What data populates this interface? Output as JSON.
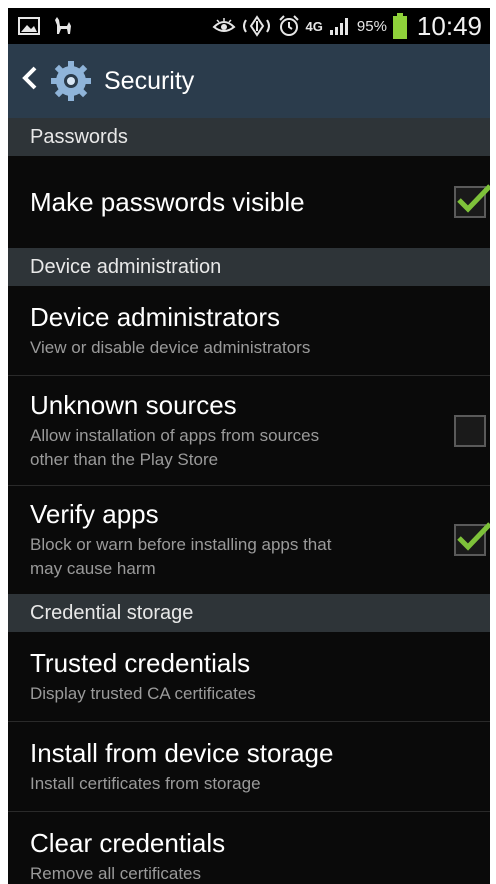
{
  "status_bar": {
    "battery_percent": "95%",
    "network": "4G",
    "time": "10:49",
    "icons": [
      "gallery-icon",
      "cat-icon",
      "eye-icon",
      "nfc-icon",
      "alarm-icon",
      "network-4g-icon",
      "signal-icon",
      "battery-icon"
    ]
  },
  "action_bar": {
    "title": "Security",
    "back_icon": "back-chevron-icon",
    "app_icon": "settings-gear-icon"
  },
  "sections": {
    "passwords": "Passwords",
    "device_admin": "Device administration",
    "credential_storage": "Credential storage"
  },
  "items": {
    "make_passwords_visible": {
      "title": "Make passwords visible",
      "checked": true
    },
    "device_administrators": {
      "title": "Device administrators",
      "subtitle": "View or disable device administrators"
    },
    "unknown_sources": {
      "title": "Unknown sources",
      "subtitle_line1": "Allow installation of apps from sources",
      "subtitle_line2": "other than the Play Store",
      "checked": false
    },
    "verify_apps": {
      "title": "Verify apps",
      "subtitle_line1": "Block or warn before installing apps that",
      "subtitle_line2": "may cause harm",
      "checked": true
    },
    "trusted_credentials": {
      "title": "Trusted credentials",
      "subtitle": "Display trusted CA certificates"
    },
    "install_from_storage": {
      "title": "Install from device storage",
      "subtitle": "Install certificates from storage"
    },
    "clear_credentials": {
      "title": "Clear credentials",
      "subtitle": "Remove all certificates"
    }
  },
  "colors": {
    "action_bar": "#2b3c4c",
    "section_header": "#2e3438",
    "background": "#0a0a0a",
    "check_green": "#7ec23a",
    "battery_green": "#8fd13a"
  }
}
